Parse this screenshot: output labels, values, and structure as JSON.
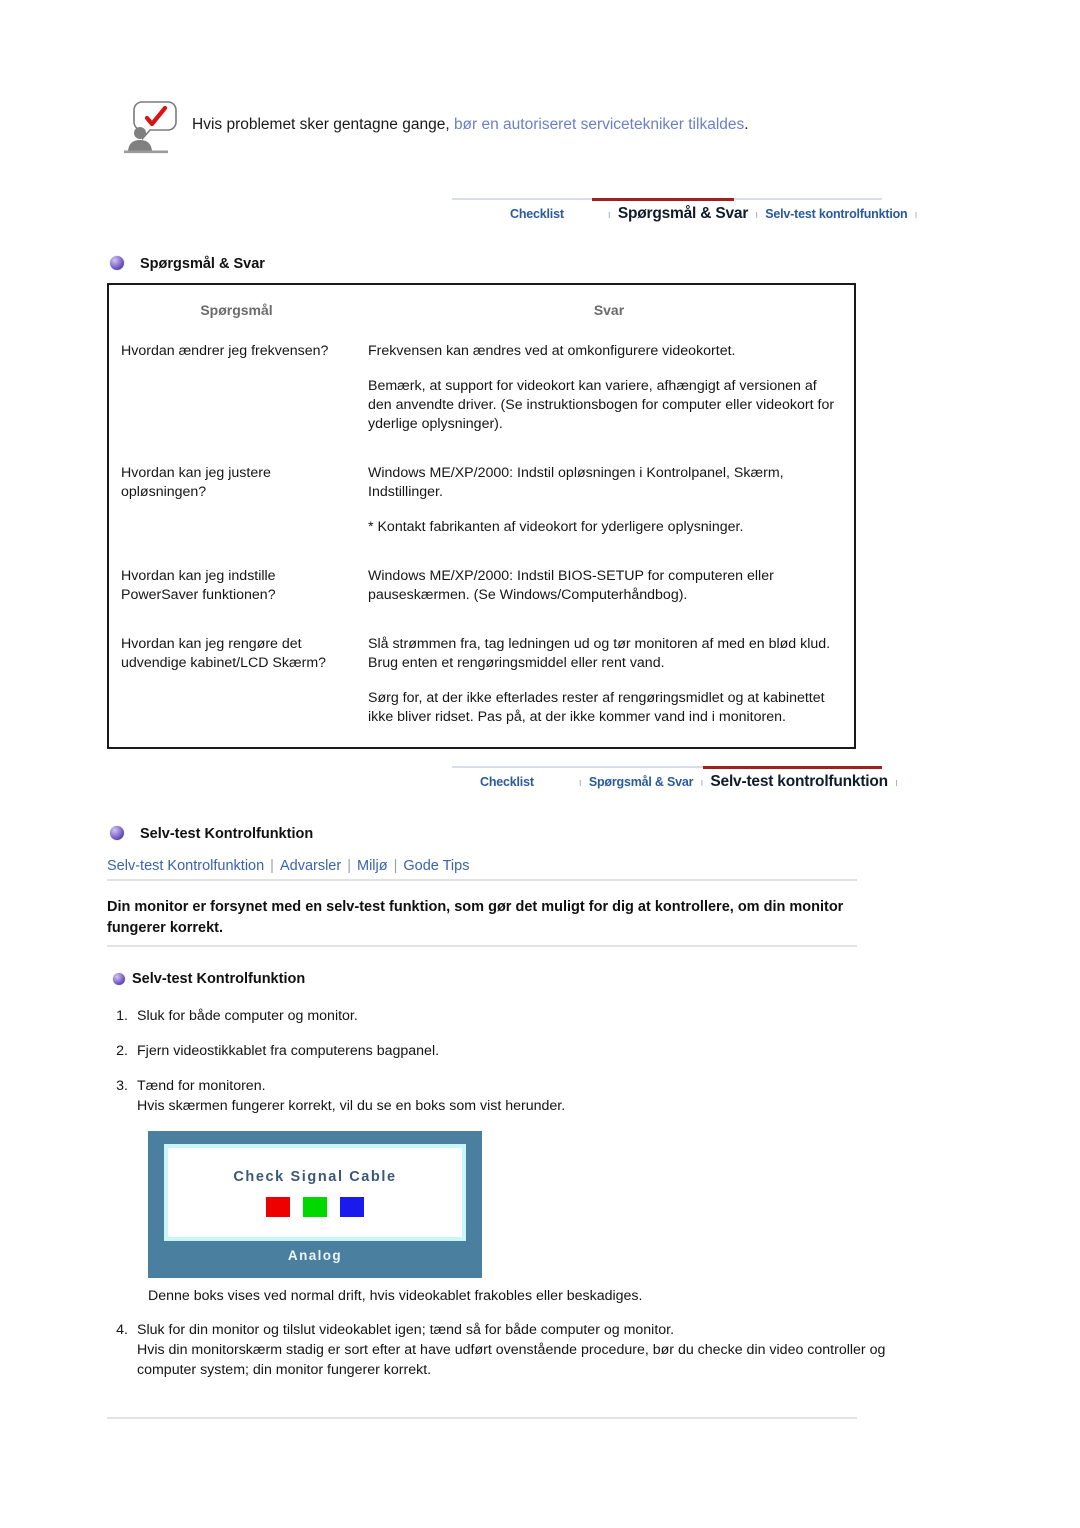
{
  "notice": {
    "icon": "person-with-checkmark-speech-bubble-icon",
    "text_plain": "Hvis problemet sker gentagne gange, ",
    "text_link": "bør en autoriseret servicetekniker tilkaldes",
    "text_end": "."
  },
  "tabnav_top": {
    "tabs": [
      {
        "label": "Checklist",
        "active": false
      },
      {
        "label": "Spørgsmål & Svar",
        "active": true
      },
      {
        "label": "Selv-test kontrolfunktion",
        "active": false
      }
    ],
    "separator": "ı",
    "accent_color": "#a01f20"
  },
  "qa_section": {
    "bullet": "purple-sphere-bullet-icon",
    "title": "Spørgsmål & Svar",
    "columns": {
      "question": "Spørgsmål",
      "answer": "Svar"
    },
    "rows": [
      {
        "question": "Hvordan ændrer jeg frekvensen?",
        "answers": [
          "Frekvensen kan ændres ved at omkonfigurere videokortet.",
          "Bemærk, at support for videokort kan variere, afhængigt af versionen af den anvendte driver.\n(Se instruktionsbogen for computer eller videokort for yderlige oplysninger)."
        ]
      },
      {
        "question": "Hvordan kan jeg justere opløsningen?",
        "answers": [
          "Windows ME/XP/2000: Indstil opløsningen i Kontrolpanel, Skærm, Indstillinger.",
          "* Kontakt fabrikanten af videokort for yderligere oplysninger."
        ]
      },
      {
        "question": "Hvordan kan jeg indstille PowerSaver funktionen?",
        "answers": [
          "Windows ME/XP/2000: Indstil BIOS-SETUP for computeren eller pauseskærmen. (Se Windows/Computerhåndbog)."
        ]
      },
      {
        "question": "Hvordan kan jeg rengøre det udvendige kabinet/LCD Skærm?",
        "answers": [
          "Slå strømmen fra, tag ledningen ud og tør monitoren af med en blød klud. Brug enten et rengøringsmiddel eller rent vand.",
          "Sørg for, at der ikke efterlades rester af rengøringsmidlet og at kabinettet ikke bliver ridset. Pas på, at der ikke kommer vand ind i monitoren."
        ]
      }
    ]
  },
  "tabnav_bottom": {
    "tabs": [
      {
        "label": "Checklist",
        "active": false
      },
      {
        "label": "Spørgsmål & Svar",
        "active": false
      },
      {
        "label": "Selv-test kontrolfunktion",
        "active": true
      }
    ],
    "separator": "ı",
    "accent_color": "#a01f20"
  },
  "selftest_section": {
    "bullet": "purple-sphere-bullet-icon",
    "title": "Selv-test Kontrolfunktion",
    "sublinks": [
      "Selv-test Kontrolfunktion",
      "Advarsler",
      "Miljø",
      "Gode Tips"
    ],
    "sublink_separator": "|",
    "intro": "Din monitor er forsynet med en selv-test funktion, som gør det muligt for dig at kontrollere, om din monitor fungerer korrekt.",
    "subheading": "Selv-test Kontrolfunktion",
    "steps": [
      {
        "num": "1.",
        "text": "Sluk for både computer og monitor."
      },
      {
        "num": "2.",
        "text": "Fjern videostikkablet fra computerens bagpanel."
      },
      {
        "num": "3.",
        "text": "Tænd for monitoren.\nHvis skærmen fungerer korrekt, vil du se en boks som vist herunder."
      }
    ],
    "step4": {
      "num": "4.",
      "text": "Sluk for din monitor og tilslut videokablet igen; tænd så for både computer og monitor.\nHvis din monitorskærm stadig er sort efter at have udført ovenstående procedure, bør du checke din video controller og computer system; din monitor fungerer korrekt."
    },
    "caption": "Denne boks vises ved normal drift, hvis videokablet frakobles eller beskadiges."
  },
  "monitor_box": {
    "message": "Check Signal Cable",
    "label": "Analog",
    "frame_color": "#4a7fa0",
    "inner_border_color": "#c9f7f7",
    "color_bars": [
      {
        "name": "red-bar",
        "color": "#ee0000"
      },
      {
        "name": "green-bar",
        "color": "#00d900"
      },
      {
        "name": "blue-bar",
        "color": "#1a1aee"
      }
    ]
  }
}
